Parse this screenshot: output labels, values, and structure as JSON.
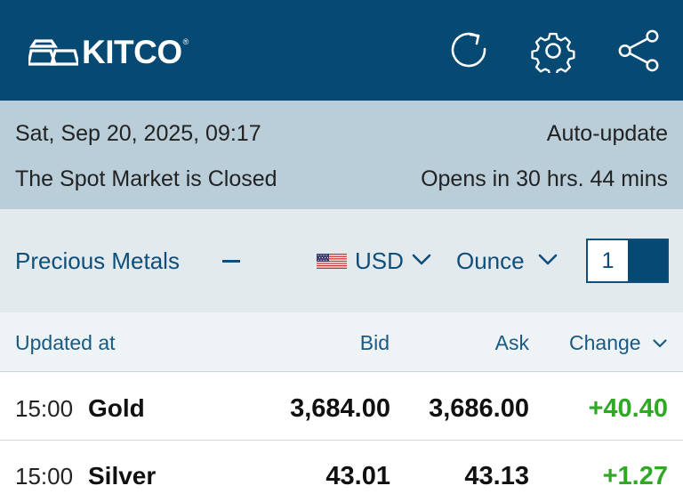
{
  "header": {
    "brand": "KITCO",
    "brand_mark": "®",
    "icons": [
      "refresh-icon",
      "gear-icon",
      "share-icon"
    ]
  },
  "status": {
    "datetime": "Sat, Sep 20, 2025, 09:17",
    "auto_update": "Auto-update",
    "market_status": "The Spot Market is Closed",
    "opens_in": "Opens in 30 hrs. 44 mins"
  },
  "controls": {
    "category": "Precious Metals",
    "currency": "USD",
    "unit": "Ounce",
    "toggle_value": "1"
  },
  "table": {
    "columns": {
      "updated": "Updated at",
      "bid": "Bid",
      "ask": "Ask",
      "change": "Change"
    },
    "rows": [
      {
        "time": "15:00",
        "metal": "Gold",
        "bid": "3,684.00",
        "ask": "3,686.00",
        "change": "+40.40"
      },
      {
        "time": "15:00",
        "metal": "Silver",
        "bid": "43.01",
        "ask": "43.13",
        "change": "+1.27"
      }
    ]
  },
  "colors": {
    "header_bg": "#064a74",
    "status_bg": "#b9ced8",
    "controls_bg": "#e3eaee",
    "accent": "#0e4e7a",
    "positive": "#2fa823"
  }
}
